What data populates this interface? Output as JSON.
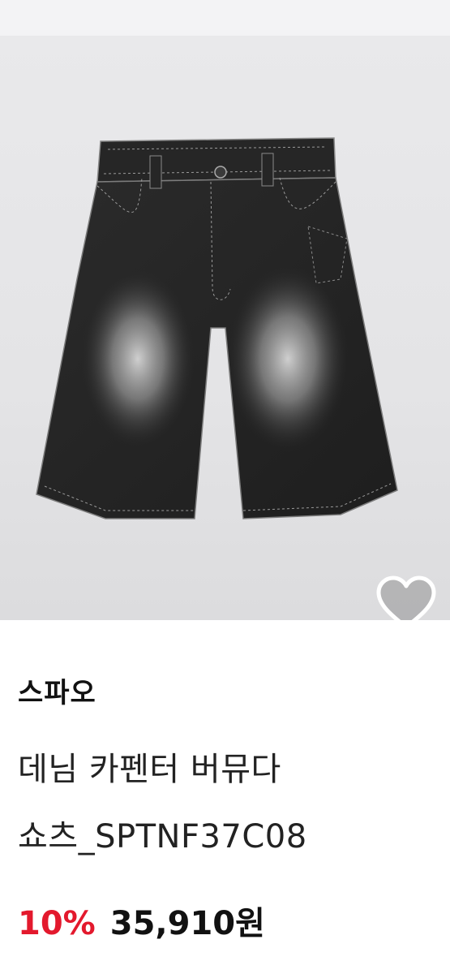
{
  "product": {
    "brand": "스파오",
    "name_line1": "데님 카펜터 버뮤다",
    "name_line2": "쇼츠_SPTNF37C08",
    "discount": "10%",
    "price": "35,910원",
    "image_icon": "denim-shorts-image",
    "wishlist_icon": "heart-outline-icon"
  },
  "colors": {
    "discount": "#e3192d",
    "text": "#111111",
    "image_background": "#e6e6e8"
  }
}
